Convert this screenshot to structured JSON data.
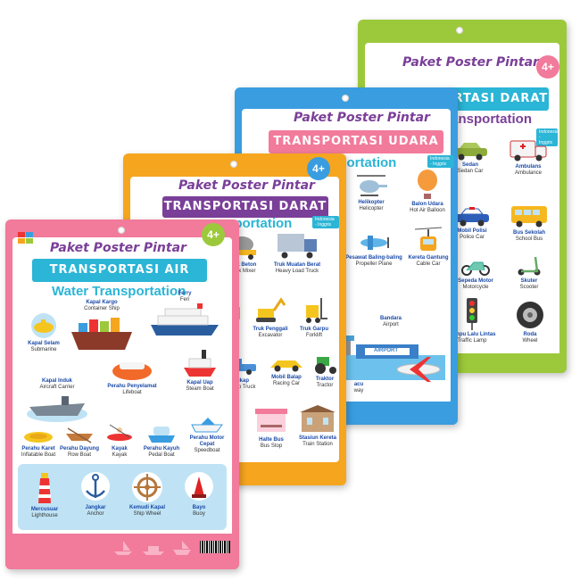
{
  "brand": "Paket Poster Pintar",
  "posters": {
    "land2": {
      "age": "4+",
      "title": "TRANSPORTASI DARAT",
      "subtitle": "Land Transportation",
      "lang": "Indonesia - Inggris",
      "items": [
        {
          "id": "Sedan",
          "en": "Sedan Car"
        },
        {
          "id": "Ambulans",
          "en": "Ambulance"
        },
        {
          "id": "Mobil Polisi",
          "en": "Police Car"
        },
        {
          "id": "Bus Sekolah",
          "en": "School Bus"
        },
        {
          "id": "Sepeda Motor",
          "en": "Motorcycle"
        },
        {
          "id": "Skuter",
          "en": "Scooter"
        },
        {
          "id": "Lampu Lalu Lintas",
          "en": "Traffic Lamp"
        },
        {
          "id": "Roda",
          "en": "Wheel"
        }
      ]
    },
    "air": {
      "title": "TRANSPORTASI UDARA",
      "subtitle": "sportation",
      "lang": "Indonesia - Inggris",
      "items": [
        {
          "id": "Helikopter",
          "en": "Helicopter"
        },
        {
          "id": "Balon Udara",
          "en": "Hot Air Balloon"
        },
        {
          "id": "Pesawat Baling-baling",
          "en": "Propeller Plane"
        },
        {
          "id": "Kereta Gantung",
          "en": "Cable Car"
        },
        {
          "id": "Bandara",
          "en": "Airport"
        },
        {
          "id": "acu",
          "en": "way"
        }
      ],
      "airport_sign": "AIRPORT"
    },
    "land1": {
      "age": "4+",
      "title": "TRANSPORTASI DARAT",
      "subtitle": "sportation",
      "lang": "Indonesia - Inggris",
      "items": [
        {
          "id": "aduk Beton",
          "en": "Truck Mixer"
        },
        {
          "id": "Truk Muatan Berat",
          "en": "Heavy Load Truck"
        },
        {
          "id": "kung",
          "en": ""
        },
        {
          "id": "Truk Penggali",
          "en": "Excavator"
        },
        {
          "id": "Truk Garpu",
          "en": "Forklift"
        },
        {
          "id": "Pikap",
          "en": "ck-up Truck"
        },
        {
          "id": "Mobil Balap",
          "en": "Racing Car"
        },
        {
          "id": "Traktor",
          "en": "Tractor"
        },
        {
          "id": "Halte Bus",
          "en": "Bus Stop"
        },
        {
          "id": "Stasiun Kereta",
          "en": "Train Station"
        }
      ]
    },
    "water": {
      "age": "4+",
      "title": "TRANSPORTASI AIR",
      "subtitle": "Water Transportation",
      "items": [
        {
          "id": "Kapal Kargo",
          "en": "Container Ship"
        },
        {
          "id": "Ferry",
          "en": "Feri"
        },
        {
          "id": "Kapal Selam",
          "en": "Submarine"
        },
        {
          "id": "Kapal Induk",
          "en": "Aircraft Carrier"
        },
        {
          "id": "Perahu Penyelamat",
          "en": "Lifeboat"
        },
        {
          "id": "Kapal Uap",
          "en": "Steam Boat"
        },
        {
          "id": "Perahu Karet",
          "en": "Inflatable Boat"
        },
        {
          "id": "Perahu Dayung",
          "en": "Row Boat"
        },
        {
          "id": "Kayak",
          "en": "Kayak"
        },
        {
          "id": "Perahu Kayuh",
          "en": "Pedal Boat"
        },
        {
          "id": "Perahu Motor Cepat",
          "en": "Speedboat"
        },
        {
          "id": "Mercusuar",
          "en": "Lighthouse"
        },
        {
          "id": "Jangkar",
          "en": "Anchor"
        },
        {
          "id": "Kemudi Kapal",
          "en": "Ship Wheel"
        },
        {
          "id": "Bayo",
          "en": "Buoy"
        }
      ]
    }
  },
  "colors": {
    "green": "#9cc93b",
    "blue": "#3a9de0",
    "orange": "#f6a51f",
    "pink": "#f27a9b",
    "title_purple": "#7a3f98",
    "title_teal": "#2bb5d6"
  }
}
